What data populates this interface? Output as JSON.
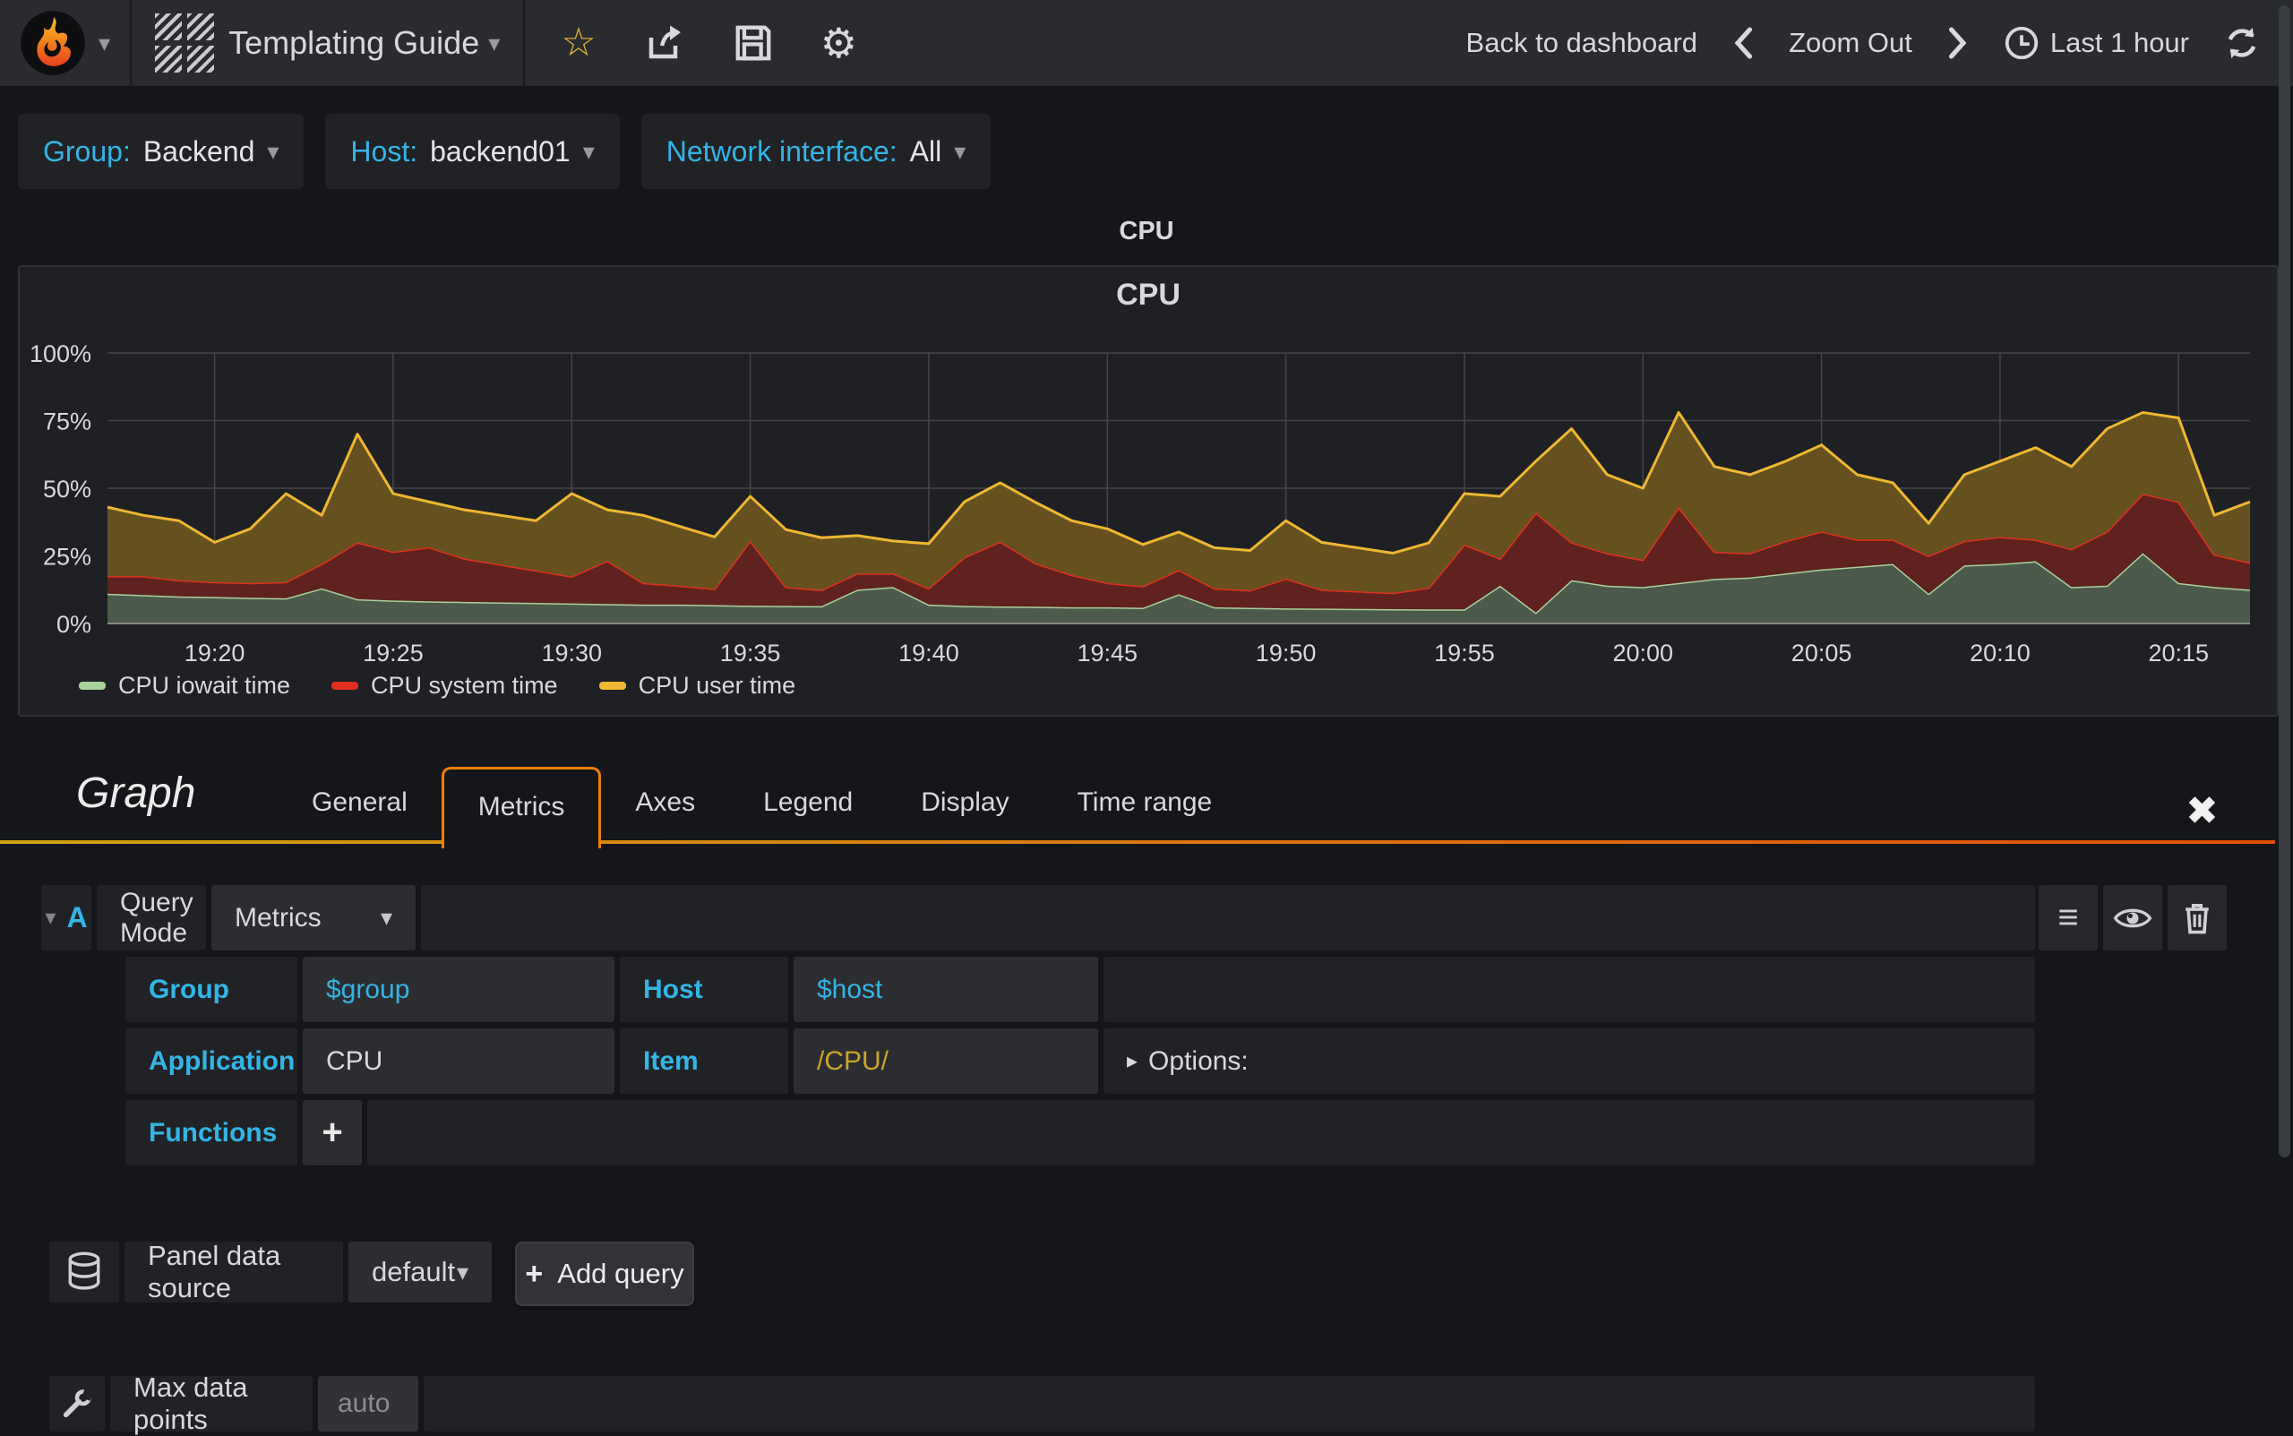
{
  "icons": {
    "caret_down": "▾",
    "options_arrow": "▸",
    "close": "✖",
    "plus": "+",
    "hamburger": "≡",
    "star": "☆",
    "gear": "⚙"
  },
  "colors": {
    "accent_cyan": "#33b5e5",
    "variable_gold": "#cda32a",
    "tab_border_orange": "#ed7e07",
    "underline_gradient_start": "#d3a10c",
    "underline_gradient_end": "#e1500a"
  },
  "navbar": {
    "title": "Templating Guide",
    "back_to_dashboard": "Back to dashboard",
    "zoom_out": "Zoom Out",
    "time_range": "Last 1 hour"
  },
  "template_vars": [
    {
      "label": "Group:",
      "value": "Backend"
    },
    {
      "label": "Host:",
      "value": "backend01"
    },
    {
      "label": "Network interface:",
      "value": "All"
    }
  ],
  "panel": {
    "header_title": "CPU"
  },
  "chart_data": {
    "type": "area",
    "stacked": true,
    "title": "CPU",
    "ylabel": "",
    "xlabel": "",
    "ylim": [
      0,
      100
    ],
    "x_start": "19:17",
    "x_end": "20:17",
    "x_step_minutes": 1,
    "grid": true,
    "legend_position": "bottom-left",
    "grid_color": "#454545",
    "axis_color": "#8a8a8a",
    "y_ticks": [
      "0%",
      "25%",
      "50%",
      "75%",
      "100%"
    ],
    "x_tick_labels": [
      {
        "min": 3,
        "label": "19:20"
      },
      {
        "min": 8,
        "label": "19:25"
      },
      {
        "min": 13,
        "label": "19:30"
      },
      {
        "min": 18,
        "label": "19:35"
      },
      {
        "min": 23,
        "label": "19:40"
      },
      {
        "min": 28,
        "label": "19:45"
      },
      {
        "min": 33,
        "label": "19:50"
      },
      {
        "min": 38,
        "label": "19:55"
      },
      {
        "min": 43,
        "label": "20:00"
      },
      {
        "min": 48,
        "label": "20:05"
      },
      {
        "min": 53,
        "label": "20:10"
      },
      {
        "min": 58,
        "label": "20:15"
      }
    ],
    "series": [
      {
        "name": "CPU iowait time",
        "color": "#a9d19c",
        "fill": "#4b5a4a",
        "values": [
          11,
          10.5,
          10,
          9.8,
          9.5,
          9.3,
          13,
          9,
          8.5,
          8.2,
          8,
          7.8,
          7.6,
          7.4,
          7.2,
          7,
          7,
          6.8,
          6.6,
          6.5,
          6.4,
          12.5,
          13.5,
          7,
          6.5,
          6.3,
          6.2,
          6,
          6,
          5.8,
          10.8,
          6,
          5.8,
          5.6,
          5.5,
          5.4,
          5.3,
          5.2,
          5.2,
          14,
          4,
          16,
          14,
          13.5,
          15,
          16.5,
          17,
          18.5,
          20,
          21,
          22,
          11,
          21.5,
          22,
          23,
          13.5,
          14,
          26,
          15,
          13.5,
          12.5
        ]
      },
      {
        "name": "CPU system time",
        "color": "#e02f1f",
        "fill": "#5f221e",
        "values": [
          6.5,
          7,
          6,
          5.5,
          5.5,
          6,
          9,
          21,
          18,
          20,
          16,
          14,
          12,
          10,
          16,
          8,
          7,
          6,
          24,
          7,
          6,
          6,
          5,
          6,
          18,
          24,
          16,
          12,
          9,
          8,
          9,
          7,
          6.5,
          11,
          7,
          6.5,
          6,
          8,
          24,
          10,
          37,
          14,
          12,
          10,
          28,
          10,
          9,
          12,
          14,
          10,
          9,
          14,
          9,
          10,
          8,
          14,
          20,
          22,
          30,
          12,
          10
        ]
      },
      {
        "name": "CPU user time",
        "color": "#efb732",
        "fill": "#655120",
        "values": [
          25.5,
          22.5,
          22,
          14.7,
          20,
          32.7,
          18,
          40,
          21.5,
          16.8,
          18,
          18.2,
          18.4,
          30.6,
          18.8,
          25,
          22,
          19.2,
          16.4,
          21.2,
          19.3,
          14,
          12,
          16.5,
          20.5,
          21.7,
          22.5,
          20,
          20,
          15.4,
          14,
          15,
          14.7,
          21.4,
          17.5,
          16.1,
          14.7,
          16.6,
          18.8,
          23,
          19,
          42,
          29,
          26.5,
          35,
          31.5,
          29,
          29.5,
          32,
          24,
          21,
          12,
          24.5,
          28,
          34,
          30.5,
          38,
          30,
          31,
          14.5,
          22.5
        ]
      }
    ]
  },
  "editor": {
    "title": "Graph",
    "tabs": [
      {
        "label": "General"
      },
      {
        "label": "Metrics"
      },
      {
        "label": "Axes"
      },
      {
        "label": "Legend"
      },
      {
        "label": "Display"
      },
      {
        "label": "Time range"
      }
    ],
    "query": {
      "letter": "A",
      "mode_label": "Query Mode",
      "mode_value": "Metrics",
      "group_label": "Group",
      "group_value": "$group",
      "host_label": "Host",
      "host_value": "$host",
      "application_label": "Application",
      "application_value": "CPU",
      "item_label": "Item",
      "item_value": "/CPU/",
      "options_label": "Options:",
      "functions_label": "Functions"
    },
    "datasource": {
      "label": "Panel data source",
      "value": "default",
      "add_query_label": "Add query"
    },
    "max_data_points": {
      "label": "Max data points",
      "placeholder": "auto"
    }
  }
}
